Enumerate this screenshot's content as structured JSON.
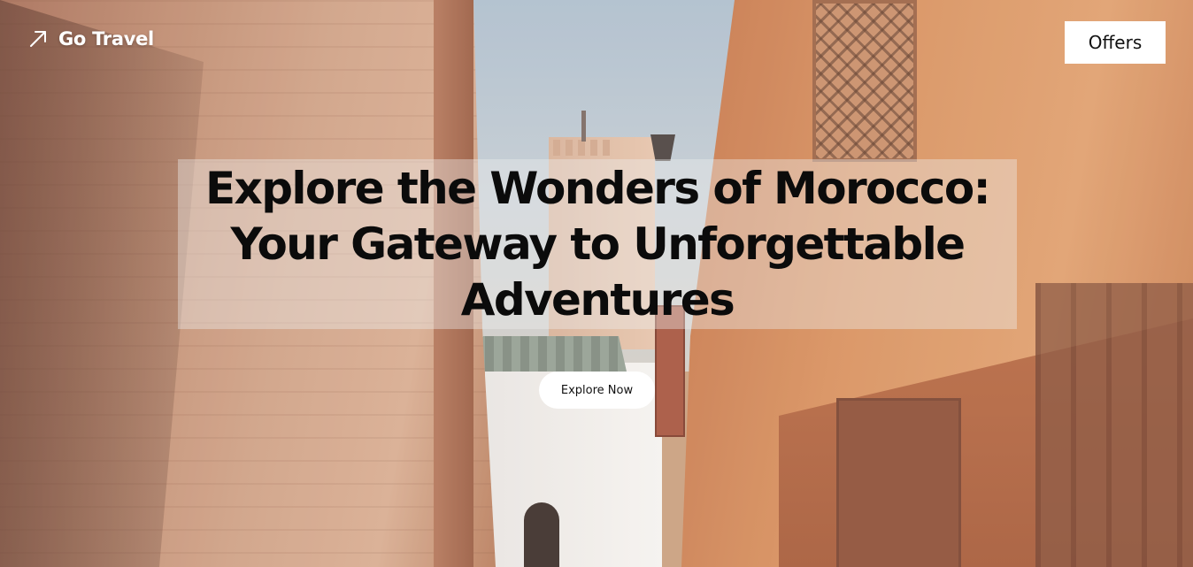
{
  "brand": {
    "name": "Go Travel",
    "icon": "arrow-up-right-icon"
  },
  "nav": {
    "offers_label": "Offers"
  },
  "hero": {
    "headline_lines": [
      "Explore the Wonders of Morocco:",
      "Your Gateway to Unforgettable",
      "Adventures"
    ],
    "cta_label": "Explore Now",
    "background_image": "marrakech-alley-photo"
  },
  "colors": {
    "headline_text": "#0b0b0b",
    "headline_panel": "rgba(238,238,238,0.40)",
    "button_background": "#ffffff",
    "brand_text": "#ffffff"
  }
}
